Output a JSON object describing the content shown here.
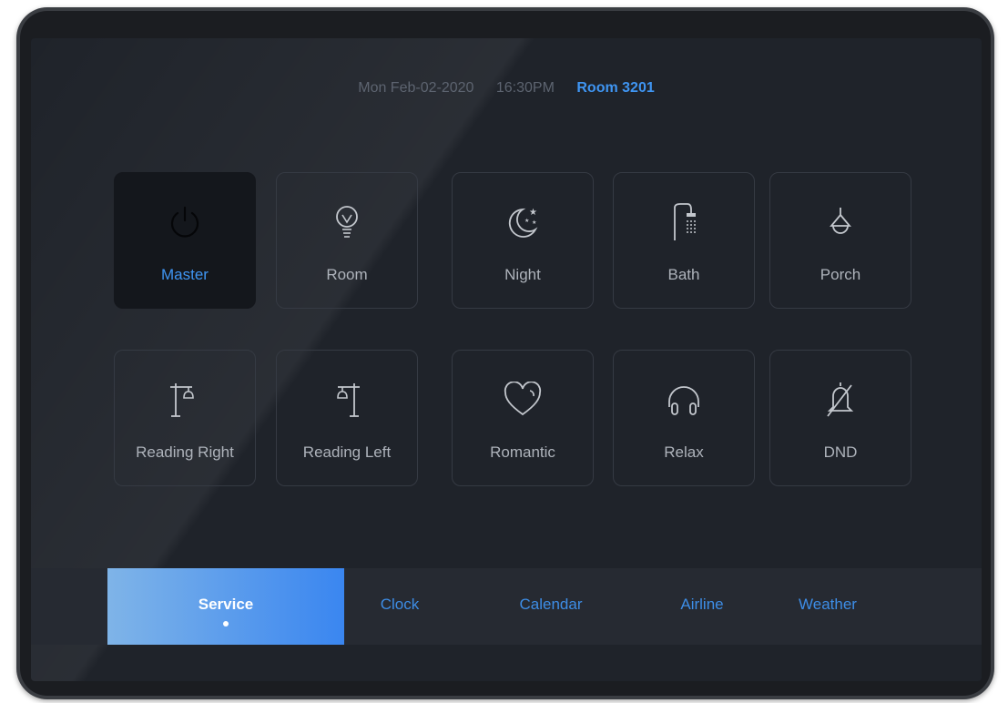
{
  "header": {
    "date": "Mon Feb-02-2020",
    "time": "16:30PM",
    "room": "Room 3201"
  },
  "tiles": [
    {
      "label": "Master",
      "icon": "power-icon",
      "active": true
    },
    {
      "label": "Room",
      "icon": "bulb-icon"
    },
    {
      "label": "Night",
      "icon": "moon-stars-icon"
    },
    {
      "label": "Bath",
      "icon": "shower-icon"
    },
    {
      "label": "Porch",
      "icon": "pendant-lamp-icon"
    },
    {
      "label": "Reading Right",
      "icon": "reading-lamp-right-icon"
    },
    {
      "label": "Reading Left",
      "icon": "reading-lamp-left-icon"
    },
    {
      "label": "Romantic",
      "icon": "heart-icon"
    },
    {
      "label": "Relax",
      "icon": "headphones-icon"
    },
    {
      "label": "DND",
      "icon": "bell-off-icon"
    }
  ],
  "tabs": [
    {
      "label": "Service",
      "active": true
    },
    {
      "label": "Clock"
    },
    {
      "label": "Calendar"
    },
    {
      "label": "Airline"
    },
    {
      "label": "Weather"
    }
  ],
  "colors": {
    "accent": "#3f95f2",
    "screen_bg": "#1f232a",
    "tab_active_start": "#7fb4e8",
    "tab_active_end": "#3a86f0"
  }
}
